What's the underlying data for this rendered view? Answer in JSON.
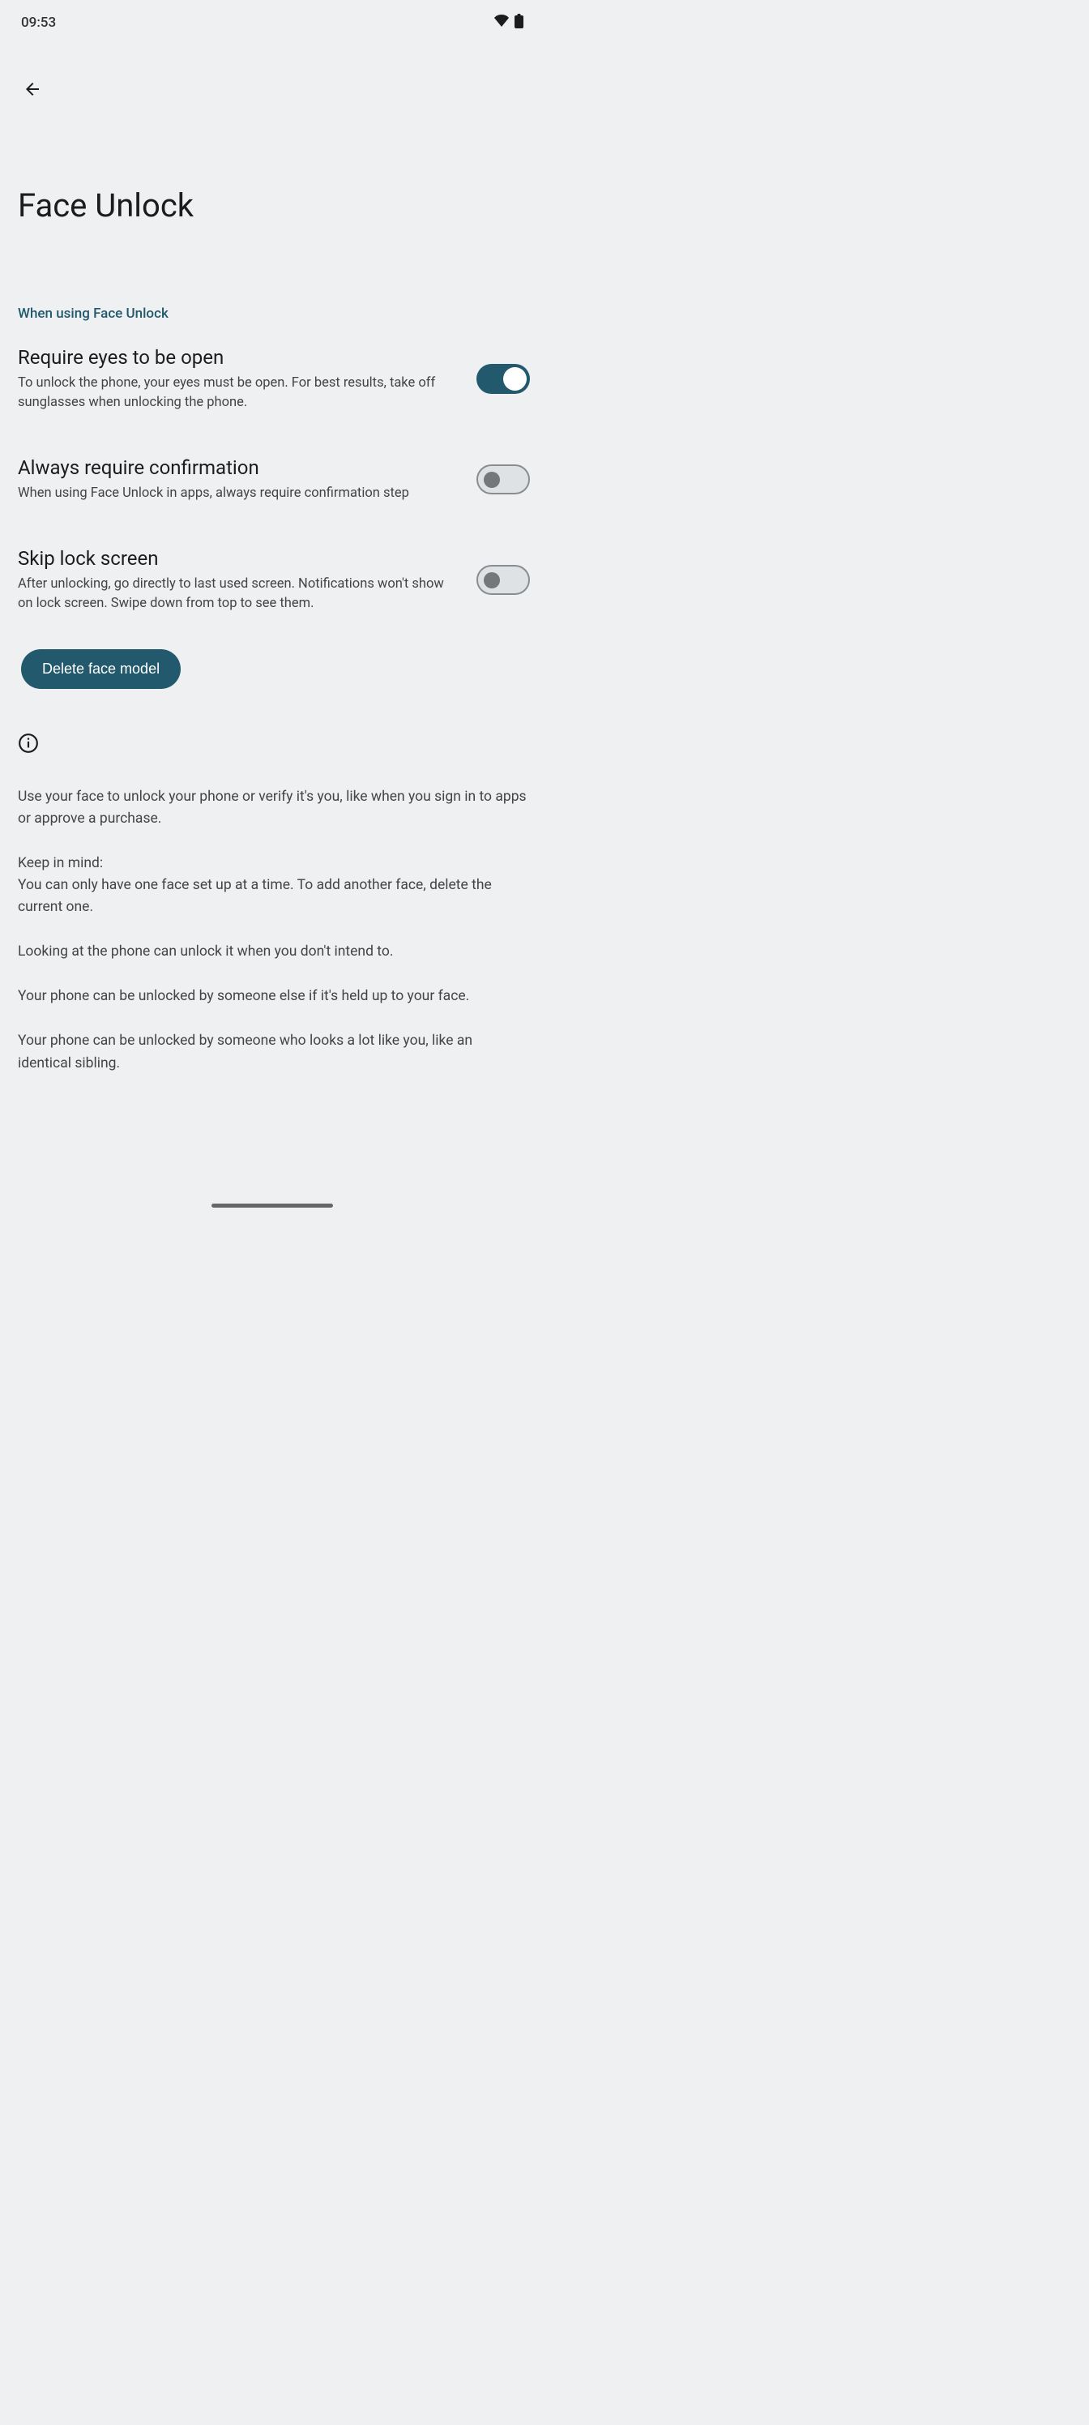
{
  "statusBar": {
    "time": "09:53"
  },
  "pageTitle": "Face Unlock",
  "sectionHeader": "When using Face Unlock",
  "settings": {
    "eyesOpen": {
      "title": "Require eyes to be open",
      "description": "To unlock the phone, your eyes must be open. For best results, take off sunglasses when unlocking the phone."
    },
    "confirmation": {
      "title": "Always require confirmation",
      "description": "When using Face Unlock in apps, always require confirmation step"
    },
    "skipLock": {
      "title": "Skip lock screen",
      "description": "After unlocking, go directly to last used screen. Notifications won't show on lock screen. Swipe down from top to see them."
    }
  },
  "deleteButton": "Delete face model",
  "info": {
    "p1": "Use your face to unlock your phone or verify it's you, like when you sign in to apps or approve a purchase.",
    "keepInMind": "Keep in mind:",
    "p2": "You can only have one face set up at a time. To add another face, delete the current one.",
    "p3": "Looking at the phone can unlock it when you don't intend to.",
    "p4": "Your phone can be unlocked by someone else if it's held up to your face.",
    "p5": "Your phone can be unlocked by someone who looks a lot like you, like an identical sibling."
  }
}
